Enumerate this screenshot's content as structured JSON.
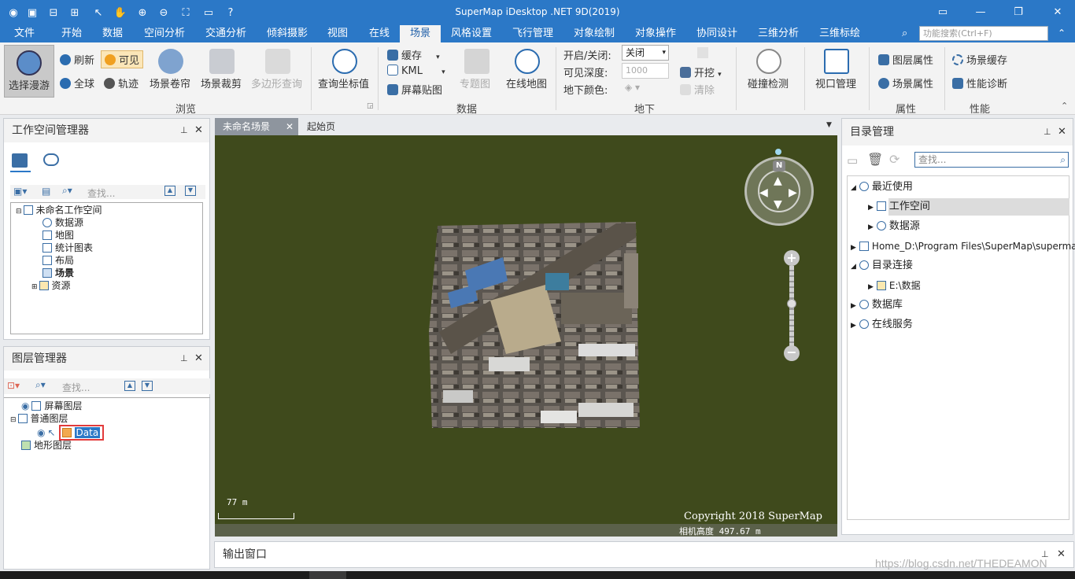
{
  "app": {
    "title": "SuperMap iDesktop .NET 9D(2019)"
  },
  "menu": {
    "tabs": [
      "文件",
      "开始",
      "数据",
      "空间分析",
      "交通分析",
      "倾斜摄影",
      "视图",
      "在线",
      "场景",
      "风格设置",
      "飞行管理",
      "对象绘制",
      "对象操作",
      "协同设计",
      "三维分析",
      "三维标绘"
    ],
    "active": "场景",
    "search_placeholder": "功能搜索(Ctrl+F)"
  },
  "ribbon": {
    "browse": {
      "select_roam": "选择漫游",
      "refresh": "刷新",
      "visible": "可见",
      "global": "全球",
      "track": "轨迹",
      "scene_curtain": "场景卷帘",
      "scene_clip": "场景裁剪",
      "polygon_query": "多边形查询",
      "query_coord": "查询坐标值",
      "label": "浏览"
    },
    "data": {
      "cache": "缓存",
      "kml": "KML",
      "screen_paste": "屏幕贴图",
      "thematic": "专题图",
      "online_map": "在线地图",
      "label": "数据"
    },
    "underground": {
      "onoff_label": "开启/关闭:",
      "onoff_value": "关闭",
      "depth_label": "可见深度:",
      "depth_value": "1000",
      "color_label": "地下颜色:",
      "excavate": "开挖",
      "clear": "清除",
      "label": "地下"
    },
    "collision": "碰撞检测",
    "viewport": "视口管理",
    "props": {
      "layer_props": "图层属性",
      "scene_props": "场景属性",
      "label": "属性"
    },
    "perf": {
      "scene_cache": "场景缓存",
      "perf_diag": "性能诊断",
      "label": "性能"
    }
  },
  "workspace": {
    "title": "工作空间管理器",
    "search": "查找...",
    "root": "未命名工作空间",
    "items": [
      "数据源",
      "地图",
      "统计图表",
      "布局",
      "场景",
      "资源"
    ]
  },
  "layers": {
    "title": "图层管理器",
    "search": "查找...",
    "items": [
      "屏幕图层",
      "普通图层",
      "Data",
      "地形图层"
    ]
  },
  "doc_tabs": [
    "未命名场景",
    "起始页"
  ],
  "scene": {
    "scale": "77 m",
    "copyright": "Copyright 2018 SuperMap",
    "camera": "相机高度 497.67 m",
    "compass": "N"
  },
  "catalog": {
    "title": "目录管理",
    "search": "查找...",
    "items": [
      "最近使用",
      "工作空间",
      "数据源",
      "Home_D:\\Program Files\\SuperMap\\superma...",
      "目录连接",
      "E:\\数据",
      "数据库",
      "在线服务"
    ]
  },
  "output": {
    "title": "输出窗口"
  },
  "watermark": "https://blog.csdn.net/THEDEAMON",
  "colors": {
    "accent": "#2b78c7",
    "scene_bg": "#3f4a1c",
    "highlight": "#e23b3b"
  }
}
